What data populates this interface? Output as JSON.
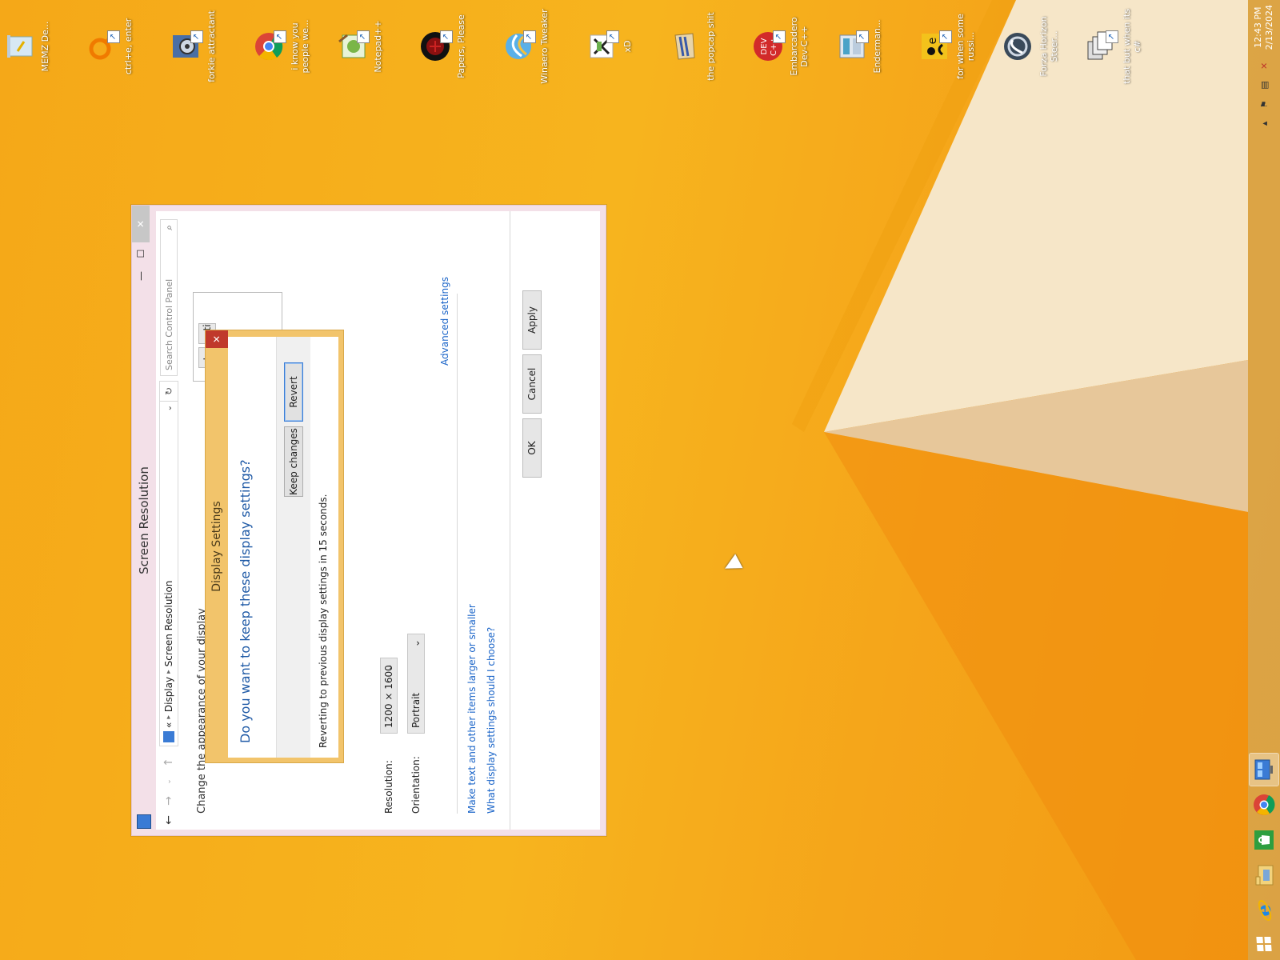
{
  "desktop": {
    "icons": [
      {
        "label": "MEMZ De...",
        "icon": "recycle-bin-icon"
      },
      {
        "label": "ctrl+e, enter",
        "icon": "magnifier-icon"
      },
      {
        "label": "forkie attractant",
        "icon": "gear-settings-icon"
      },
      {
        "label": "i know you people we...",
        "icon": "chrome-icon"
      },
      {
        "label": "Notepad++",
        "icon": "notepadpp-icon"
      },
      {
        "label": "Papers, Please",
        "icon": "papers-please-icon"
      },
      {
        "label": "Winaero Tweaker",
        "icon": "winaero-icon"
      },
      {
        "label": "xD",
        "icon": "xd-icon"
      },
      {
        "label": "the popcap shit",
        "icon": "popcap-icon"
      },
      {
        "label": "Embarcadero Dev-C++",
        "icon": "devcpp-icon"
      },
      {
        "label": "Enderman...",
        "icon": "enderman-icon"
      },
      {
        "label": "for when some russi...",
        "icon": "russi-icon"
      },
      {
        "label": "Forza Horizon Steer...",
        "icon": "steering-wheel-icon"
      },
      {
        "label": "that but when its c#",
        "icon": "windows-stack-icon"
      }
    ]
  },
  "taskbar": {
    "apps": [
      {
        "icon": "internet-explorer-icon",
        "active": false
      },
      {
        "icon": "file-explorer-icon",
        "active": false
      },
      {
        "icon": "store-icon",
        "active": false
      },
      {
        "icon": "chrome-icon",
        "active": false
      },
      {
        "icon": "control-panel-icon",
        "active": true
      }
    ],
    "tray": {
      "icons": [
        "chevron-up-icon",
        "flag-icon",
        "network-icon",
        "volume-muted-icon"
      ],
      "time": "12:43 PM",
      "date": "2/13/2024"
    }
  },
  "window": {
    "title": "Screen Resolution",
    "address": {
      "crumbs": [
        "«",
        "Display",
        "Screen Resolution"
      ]
    },
    "search_placeholder": "Search Control Panel",
    "heading_partial": "Change the appearance of your display",
    "detect_label": "Detect",
    "identify_label": "Identify",
    "resolution_label": "Resolution:",
    "resolution_value": "1200 × 1600",
    "orientation_label": "Orientation:",
    "orientation_value": "Portrait",
    "advanced_link": "Advanced settings",
    "link1": "Make text and other items larger or smaller",
    "link2": "What display settings should I choose?",
    "ok_label": "OK",
    "cancel_label": "Cancel",
    "apply_label": "Apply"
  },
  "dialog": {
    "title": "Display Settings",
    "question": "Do you want to keep these display settings?",
    "keep_label": "Keep changes",
    "revert_label": "Revert",
    "message": "Reverting to previous display settings in 15 seconds."
  },
  "colors": {
    "desktop": "#f7b020",
    "dialog_frame": "#f2c46b",
    "link": "#1a64c8",
    "dialog_question": "#1f5aa6"
  }
}
